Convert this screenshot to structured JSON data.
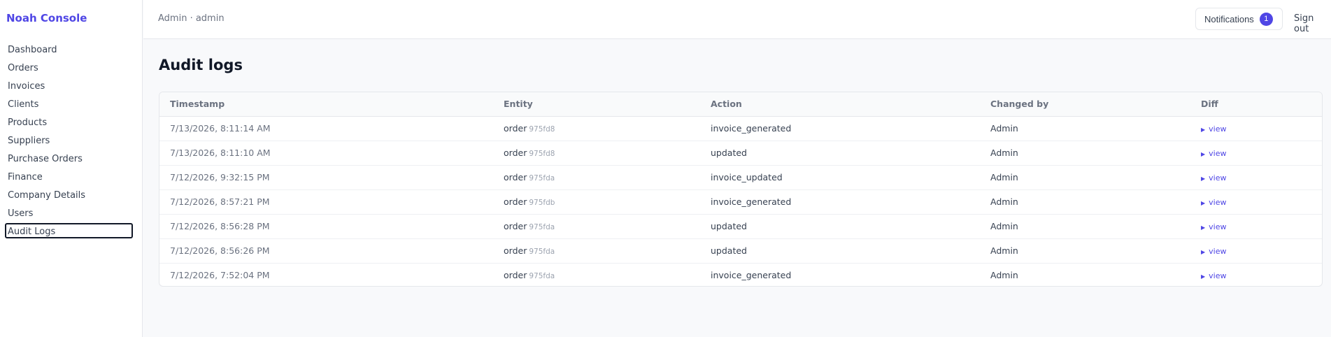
{
  "app": {
    "brand": "Noah Console"
  },
  "sidebar": {
    "items": [
      {
        "label": "Dashboard"
      },
      {
        "label": "Orders"
      },
      {
        "label": "Invoices"
      },
      {
        "label": "Clients"
      },
      {
        "label": "Products"
      },
      {
        "label": "Suppliers"
      },
      {
        "label": "Purchase Orders"
      },
      {
        "label": "Finance"
      },
      {
        "label": "Company Details"
      },
      {
        "label": "Users"
      },
      {
        "label": "Audit Logs",
        "active": true
      }
    ]
  },
  "header": {
    "breadcrumb": "Admin · admin",
    "notifications_label": "Notifications",
    "notifications_count": "1",
    "signout_label": "Sign out"
  },
  "main": {
    "title": "Audit logs",
    "columns": [
      "Timestamp",
      "Entity",
      "Action",
      "Changed by",
      "Diff"
    ],
    "rows": [
      {
        "timestamp": "7/13/2026, 8:11:14 AM",
        "entity": "order",
        "entity_id": "975fd8",
        "action": "invoice_generated",
        "changed_by": "Admin",
        "diff": "view"
      },
      {
        "timestamp": "7/13/2026, 8:11:10 AM",
        "entity": "order",
        "entity_id": "975fd8",
        "action": "updated",
        "changed_by": "Admin",
        "diff": "view"
      },
      {
        "timestamp": "7/12/2026, 9:32:15 PM",
        "entity": "order",
        "entity_id": "975fda",
        "action": "invoice_updated",
        "changed_by": "Admin",
        "diff": "view"
      },
      {
        "timestamp": "7/12/2026, 8:57:21 PM",
        "entity": "order",
        "entity_id": "975fdb",
        "action": "invoice_generated",
        "changed_by": "Admin",
        "diff": "view"
      },
      {
        "timestamp": "7/12/2026, 8:56:28 PM",
        "entity": "order",
        "entity_id": "975fda",
        "action": "updated",
        "changed_by": "Admin",
        "diff": "view"
      },
      {
        "timestamp": "7/12/2026, 8:56:26 PM",
        "entity": "order",
        "entity_id": "975fda",
        "action": "updated",
        "changed_by": "Admin",
        "diff": "view"
      },
      {
        "timestamp": "7/12/2026, 7:52:04 PM",
        "entity": "order",
        "entity_id": "975fda",
        "action": "invoice_generated",
        "changed_by": "Admin",
        "diff": "view"
      }
    ]
  },
  "icons": {
    "diff_toggle": "triangle-right-icon"
  },
  "colors": {
    "accent": "#4f46e5"
  }
}
